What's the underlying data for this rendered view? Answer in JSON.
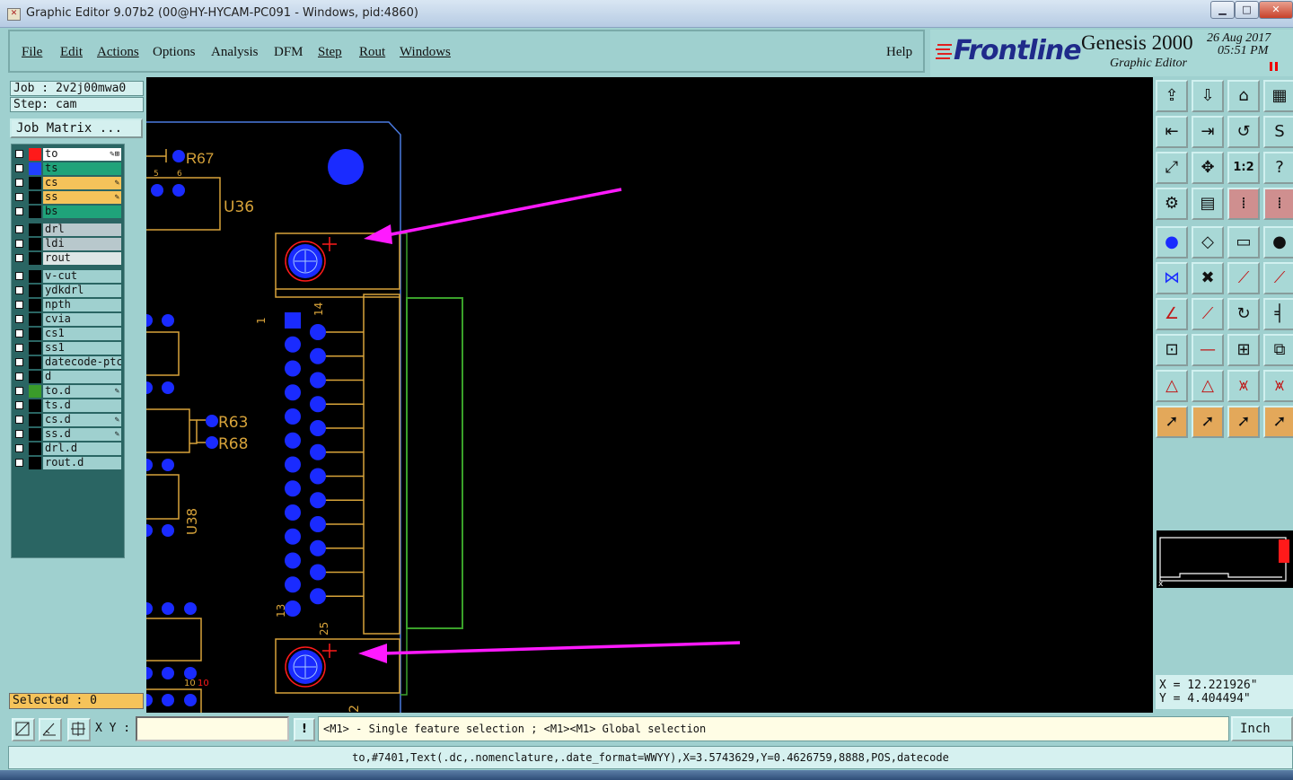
{
  "window": {
    "title": "Graphic Editor 9.07b2 (00@HY-HYCAM-PC091 - Windows, pid:4860)",
    "minimize": "▁",
    "maximize": "□",
    "close": "✕"
  },
  "menu": {
    "items": [
      "File",
      "Edit",
      "Actions",
      "Options",
      "Analysis",
      "DFM",
      "Step",
      "Rout",
      "Windows"
    ],
    "help": "Help"
  },
  "brand": {
    "logo": "Frontline",
    "product": "Genesis 2000",
    "subtitle": "Graphic Editor",
    "date": "26 Aug 2017",
    "time": "05:51 PM"
  },
  "job": {
    "job_label": "Job : 2v2j00mwa0",
    "step_label": "Step: cam",
    "matrix_button": "Job Matrix ..."
  },
  "layers": [
    {
      "name": "to",
      "color": "#ff1a1a",
      "bg": "#ffffff",
      "edit": "✎⊞"
    },
    {
      "name": "ts",
      "color": "#2040ff",
      "bg": "#1fa37a",
      "edit": ""
    },
    {
      "name": "cs",
      "color": "#000000",
      "bg": "#f5c35a",
      "edit": "✎"
    },
    {
      "name": "ss",
      "color": "#000000",
      "bg": "#f5c35a",
      "edit": "✎"
    },
    {
      "name": "bs",
      "color": "#000000",
      "bg": "#1fa37a",
      "edit": ""
    },
    {
      "name": "drl",
      "color": "#000000",
      "bg": "#b8c8cc",
      "edit": ""
    },
    {
      "name": "ldi",
      "color": "#000000",
      "bg": "#b8c8cc",
      "edit": ""
    },
    {
      "name": "rout",
      "color": "#000000",
      "bg": "#dde6e6",
      "edit": ""
    },
    {
      "name": "v-cut",
      "color": "#000000",
      "bg": "#9fd0cf",
      "edit": ""
    },
    {
      "name": "ydkdrl",
      "color": "#000000",
      "bg": "#9fd0cf",
      "edit": ""
    },
    {
      "name": "npth",
      "color": "#000000",
      "bg": "#9fd0cf",
      "edit": ""
    },
    {
      "name": "cvia",
      "color": "#000000",
      "bg": "#9fd0cf",
      "edit": ""
    },
    {
      "name": "cs1",
      "color": "#000000",
      "bg": "#9fd0cf",
      "edit": ""
    },
    {
      "name": "ss1",
      "color": "#000000",
      "bg": "#9fd0cf",
      "edit": ""
    },
    {
      "name": "datecode-ptc",
      "color": "#000000",
      "bg": "#9fd0cf",
      "edit": ""
    },
    {
      "name": "d",
      "color": "#000000",
      "bg": "#9fd0cf",
      "edit": ""
    },
    {
      "name": "to.d",
      "color": "#3a9b2a",
      "bg": "#9fd0cf",
      "edit": "✎"
    },
    {
      "name": "ts.d",
      "color": "#000000",
      "bg": "#9fd0cf",
      "edit": ""
    },
    {
      "name": "cs.d",
      "color": "#000000",
      "bg": "#9fd0cf",
      "edit": "✎"
    },
    {
      "name": "ss.d",
      "color": "#000000",
      "bg": "#9fd0cf",
      "edit": "✎"
    },
    {
      "name": "drl.d",
      "color": "#000000",
      "bg": "#9fd0cf",
      "edit": ""
    },
    {
      "name": "rout.d",
      "color": "#000000",
      "bg": "#9fd0cf",
      "edit": ""
    }
  ],
  "selected_label": "Selected : 0",
  "canvas": {
    "labels": {
      "r67": "R67",
      "u36": "U36",
      "r63": "R63",
      "r68": "R68",
      "u38": "U38",
      "pin1": "1",
      "pin14": "14",
      "pin13": "13",
      "pin25": "25",
      "pin2": "2",
      "pin5": "5",
      "pin6": "6",
      "pin10a": "10",
      "pin10b": "10"
    },
    "colors": {
      "background": "#000000",
      "pad": "#1a2bff",
      "silk": "#d7a33a",
      "outline": "#3aa12a",
      "rout": "#4a7ae0",
      "arrow": "#ff1aff",
      "marker": "#ff1a1a"
    }
  },
  "toolbar_icons": [
    "open-icon",
    "save-icon",
    "home-icon",
    "layout-icon",
    "import-icon",
    "export-icon",
    "undo-icon",
    "redo-icon",
    "zoom-fit-icon",
    "zoom-home-icon",
    "zoom-1to2-icon",
    "help-icon",
    "snap-icon",
    "grid-icon",
    "pad-icon-red",
    "pad-icon-red-2",
    "select-pad-icon",
    "select-area-icon",
    "measure-icon",
    "circle-icon",
    "connect-icon",
    "cross-icon",
    "line-point-icon",
    "line-point-2-icon",
    "angle-icon",
    "diagonal-icon",
    "rotate-icon",
    "mirror-icon",
    "snap-point-icon",
    "line-red-icon",
    "center-icon",
    "cluster-icon",
    "triangle-icon",
    "triangle-2-icon",
    "arch-icon",
    "arch-2-icon",
    "pointer-icon",
    "pointer-2-icon",
    "pointer-3-icon",
    "pointer-4-icon"
  ],
  "coordinates": {
    "x": "X = 12.221926\"",
    "y": "Y = 4.404494\""
  },
  "command": {
    "xy_label": "X Y :",
    "xy_value": "",
    "bang": "!",
    "prompt": "<M1> - Single feature selection ; <M1><M1> Global selection",
    "units": "Inch"
  },
  "status": "to,#7401,Text(.dc,.nomenclature,.date_format=WWYY),X=3.5743629,Y=0.4626759,8888,POS,datecode"
}
